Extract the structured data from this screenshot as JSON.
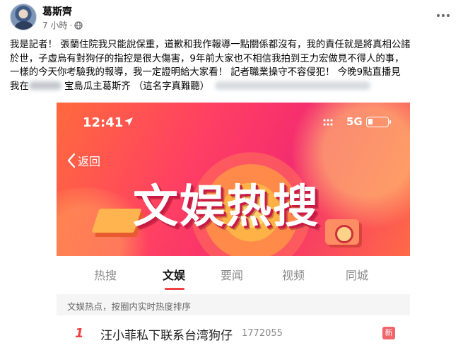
{
  "post": {
    "author": "葛斯齊",
    "timestamp": "7 小時",
    "separator": "·",
    "privacy_icon": "globe-icon",
    "text_lines": [
      "我是記者！ 張蘭住院我只能說保重，道歉和我作報導一點關係都沒有，我的責任就是將真相公諸",
      "於世，子虛烏有對狗仔的指控是很大傷害，9年前大家也不相信我拍到王力宏做見不得人的事，",
      "一樣的今天你考驗我的報導，我一定證明給大家看！ 記者職業操守不容侵犯！  今晚9點直播見"
    ],
    "last_line_prefix": "我在",
    "last_line_mid": " 宝島瓜主葛斯齐 （這名字真難聽）"
  },
  "screenshot": {
    "status_bar": {
      "time": "12:41",
      "network": "5G"
    },
    "back_label": "返回",
    "banner_title": "文娱热搜",
    "tabs": [
      "热搜",
      "文娱",
      "要闻",
      "视频",
      "同城"
    ],
    "active_tab": "文娱",
    "section_header": "文娱热点，按圈内实时热度排序",
    "hot_list": [
      {
        "rank": "1",
        "title": "汪小菲私下联系台湾狗仔",
        "count": "1772055",
        "badge": "新"
      }
    ]
  },
  "colors": {
    "brand_red": "#f04142",
    "banner_gradient": [
      "#ff6a3d",
      "#f42d6e"
    ],
    "new_badge": "#f0646a"
  }
}
